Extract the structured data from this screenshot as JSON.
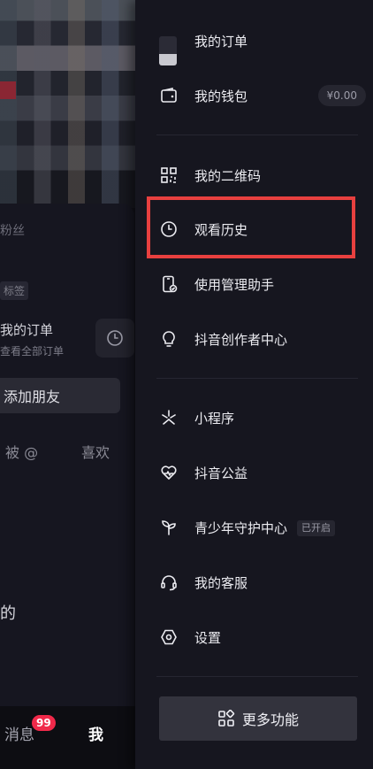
{
  "background": {
    "fans_label": "粉丝",
    "tag_label": "标签",
    "orders_title": "我的订单",
    "orders_sub": "查看全部订单",
    "add_friend_label": "添加朋友",
    "tab_mention": "被 @",
    "tab_like": "喜欢",
    "partial_text": "的",
    "nav_message": "消息",
    "nav_message_badge": "99",
    "nav_me": "我"
  },
  "drawer": {
    "items": [
      {
        "label": "我的订单",
        "icon": "order-thumbnail"
      },
      {
        "label": "我的钱包",
        "icon": "wallet-icon",
        "value": "¥0.00"
      },
      {
        "label": "我的二维码",
        "icon": "qrcode-icon"
      },
      {
        "label": "观看历史",
        "icon": "clock-icon"
      },
      {
        "label": "使用管理助手",
        "icon": "phone-check-icon"
      },
      {
        "label": "抖音创作者中心",
        "icon": "lightbulb-icon"
      },
      {
        "label": "小程序",
        "icon": "mini-program-icon"
      },
      {
        "label": "抖音公益",
        "icon": "heart-charity-icon"
      },
      {
        "label": "青少年守护中心",
        "icon": "sprout-icon",
        "badge": "已开启"
      },
      {
        "label": "我的客服",
        "icon": "headset-icon"
      },
      {
        "label": "设置",
        "icon": "settings-hexagon-icon"
      }
    ],
    "more_button_label": "更多功能"
  },
  "colors": {
    "drawer_bg": "#16161f",
    "highlight_border": "#e8403f",
    "badge_red": "#f0294a"
  }
}
